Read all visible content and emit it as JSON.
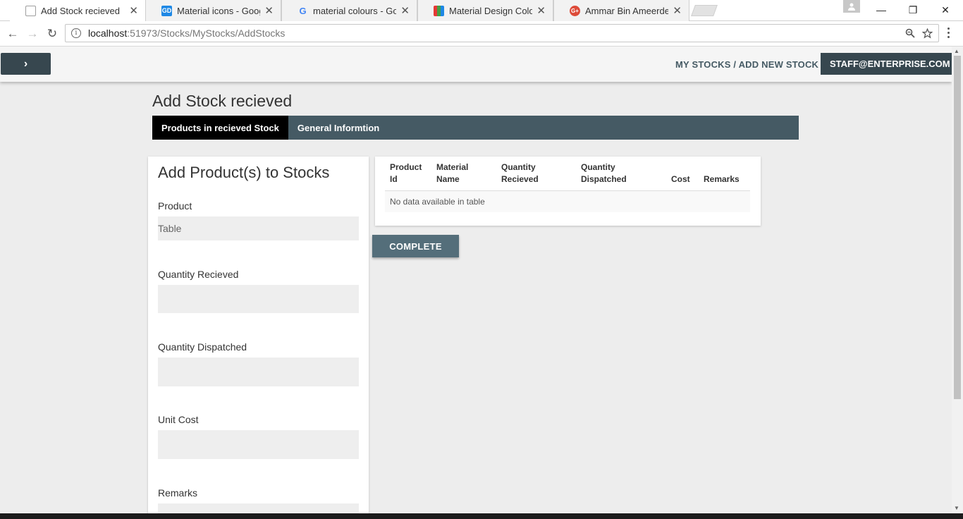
{
  "browser": {
    "tabs": [
      {
        "title": "Add Stock recieved",
        "close": "✕",
        "favicon_label": "",
        "favicon_color": "#ffffff"
      },
      {
        "title": "Material icons - Google D",
        "close": "✕",
        "favicon_label": "GD",
        "favicon_color": "#1e88e5"
      },
      {
        "title": "material colours - Googl",
        "close": "✕",
        "favicon_label": "G",
        "favicon_color": "#ffffff"
      },
      {
        "title": "Material Design Colors, M",
        "close": "✕",
        "favicon_label": "",
        "favicon_color": "#e53935"
      },
      {
        "title": "Ammar Bin Ameerdeen -",
        "close": "✕",
        "favicon_label": "G+",
        "favicon_color": "#dd4b39"
      }
    ],
    "window_controls": {
      "minimize": "—",
      "restore": "❐",
      "close": "✕"
    },
    "url_host": "localhost",
    "url_path": ":51973/Stocks/MyStocks/AddStocks",
    "nav": {
      "back": "←",
      "forward": "→",
      "reload": "↻"
    }
  },
  "appbar": {
    "menu_icon": "›",
    "breadcrumb": "MY STOCKS / ADD NEW STOCK",
    "user": "STAFF@ENTERPRISE.COM",
    "user_caret": "▼"
  },
  "page_title": "Add Stock recieved",
  "tabs": [
    {
      "label": "Products in recieved Stock",
      "selected": true
    },
    {
      "label": "General Informtion",
      "selected": false
    }
  ],
  "form": {
    "heading": "Add Product(s) to Stocks",
    "fields": [
      {
        "label": "Product",
        "value": "Table"
      },
      {
        "label": "Quantity Recieved",
        "value": ""
      },
      {
        "label": "Quantity Dispatched",
        "value": ""
      },
      {
        "label": "Unit Cost",
        "value": ""
      },
      {
        "label": "Remarks",
        "value": ""
      }
    ]
  },
  "table": {
    "columns": [
      {
        "line1": "Product",
        "line2": "Id"
      },
      {
        "line1": "Material",
        "line2": "Name"
      },
      {
        "line1": "Quantity",
        "line2": "Recieved"
      },
      {
        "line1": "Quantity",
        "line2": "Dispatched"
      },
      {
        "line1": "",
        "line2": "Cost"
      },
      {
        "line1": "",
        "line2": "Remarks"
      }
    ],
    "empty_message": "No data available in table"
  },
  "complete_button": "COMPLETE"
}
